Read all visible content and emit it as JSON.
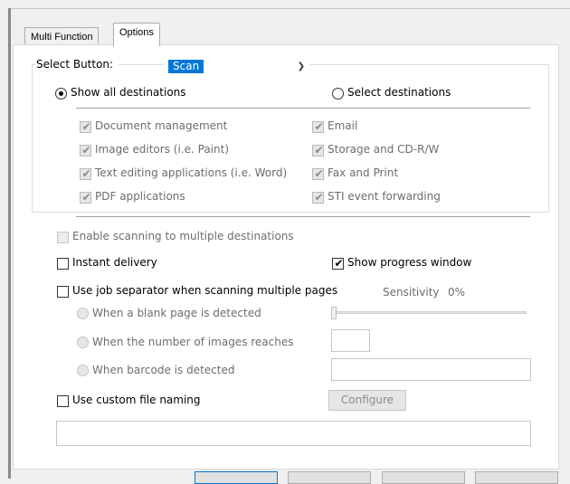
{
  "tabs": [
    {
      "label": "Multi Function",
      "active": false
    },
    {
      "label": "Options",
      "active": true
    }
  ],
  "select_button": {
    "label": "Select Button:",
    "value": "Scan"
  },
  "destinations": {
    "show_all": {
      "label": "Show all destinations",
      "selected": true
    },
    "select": {
      "label": "Select destinations",
      "selected": false
    },
    "items": [
      {
        "label": "Document management",
        "checked": true
      },
      {
        "label": "Image editors (i.e. Paint)",
        "checked": true
      },
      {
        "label": "Text editing applications (i.e. Word)",
        "checked": true
      },
      {
        "label": "PDF applications",
        "checked": true
      },
      {
        "label": "Email",
        "checked": true
      },
      {
        "label": "Storage and CD-R/W",
        "checked": true
      },
      {
        "label": "Fax and Print",
        "checked": true
      },
      {
        "label": "STI event forwarding",
        "checked": true
      }
    ]
  },
  "options": {
    "enable_multiple": {
      "label": "Enable scanning to multiple destinations",
      "checked": false,
      "enabled": false
    },
    "instant_delivery": {
      "label": "Instant delivery",
      "checked": false
    },
    "show_progress": {
      "label": "Show progress window",
      "checked": true
    },
    "job_separator": {
      "label": "Use job separator when scanning multiple pages",
      "checked": false
    },
    "sensitivity_label": "Sensitivity",
    "sensitivity_value": "0%",
    "sensitivity_level": 0,
    "blank_page": {
      "label": "When a blank page is detected"
    },
    "num_images": {
      "label": "When the number of images reaches"
    },
    "barcode": {
      "label": "When barcode is detected"
    },
    "custom_naming": {
      "label": "Use custom file naming",
      "checked": false
    },
    "configure_label": "Configure"
  },
  "colors": {
    "accent": "#0078d7",
    "disabled_text": "#6d6d6d",
    "panel_bg": "#ffffff",
    "window_bg": "#f0f0f0"
  }
}
